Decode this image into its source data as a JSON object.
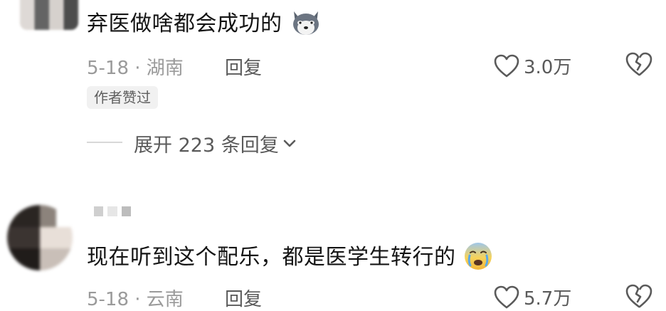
{
  "comments": [
    {
      "text": "弃医做啥都会成功的",
      "emoji": "husky-dog-emoji",
      "date_location": "5-18 · 湖南",
      "reply_label": "回复",
      "likes": "3.0万",
      "author_tag": "作者赞过",
      "expand_replies": "展开 223 条回复"
    },
    {
      "text": "现在听到这个配乐，都是医学生转行的",
      "emoji": "crying-face-emoji",
      "date_location": "5-18 · 云南",
      "reply_label": "回复",
      "likes": "5.7万"
    }
  ],
  "icons": {
    "like": "heart-outline-icon",
    "dislike": "broken-heart-icon",
    "chevron": "chevron-down-icon"
  },
  "colors": {
    "text_primary": "#141414",
    "text_meta": "#9a9a9a",
    "text_secondary": "#5a5a5a",
    "tag_bg": "#f1f1f1"
  }
}
